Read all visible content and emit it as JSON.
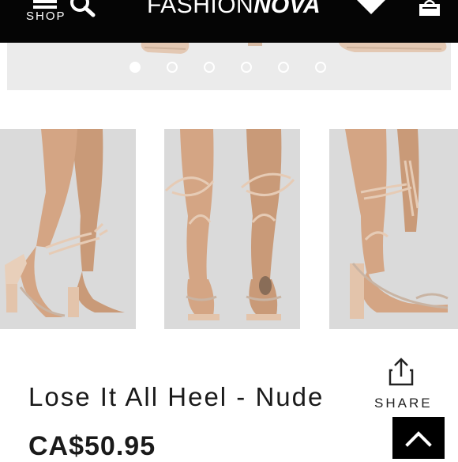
{
  "header": {
    "shop_label": "SHOP",
    "logo_part1": "FASHION",
    "logo_part2": "NOVA",
    "icons": [
      "menu-icon",
      "search-icon",
      "heart-icon",
      "bag-icon"
    ]
  },
  "carousel": {
    "slide_count": 6,
    "active_index": 0
  },
  "product": {
    "title": "Lose It All Heel - Nude",
    "price": "CA$50.95",
    "share_label": "SHARE"
  },
  "colors": {
    "header_bg": "#050505",
    "carousel_bg": "#ebebeb",
    "text": "#1a1a1a",
    "nude": "#e6cbb5"
  }
}
